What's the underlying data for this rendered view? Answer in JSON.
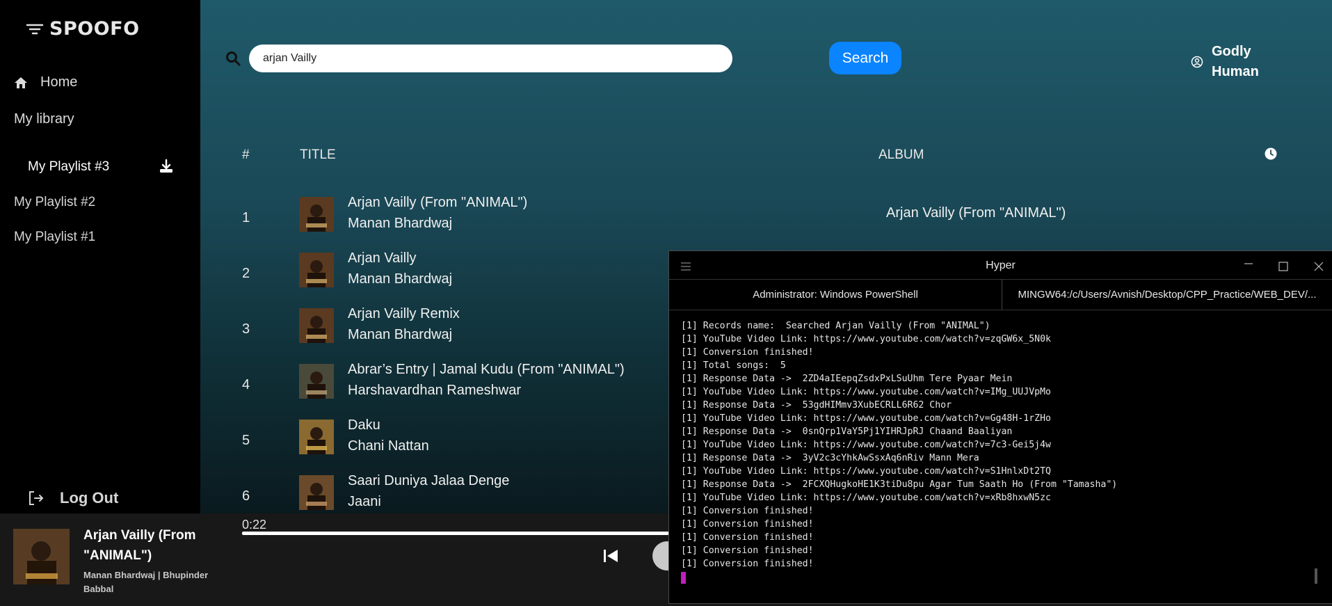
{
  "app": {
    "logo": "SPOOFO"
  },
  "sidebar": {
    "home": "Home",
    "library": "My library",
    "playlists": [
      "My Playlist #3",
      "My Playlist #2",
      "My Playlist #1"
    ],
    "logout": "Log Out"
  },
  "search": {
    "value": "arjan Vailly",
    "button": "Search"
  },
  "user": {
    "name": "Godly Human"
  },
  "table": {
    "headers": {
      "num": "#",
      "title": "TITLE",
      "album": "ALBUM"
    },
    "rows": [
      {
        "num": "1",
        "title": "Arjan Vailly (From \"ANIMAL\")",
        "artist": "Manan Bhardwaj",
        "album": "Arjan Vailly (From \"ANIMAL\")"
      },
      {
        "num": "2",
        "title": "Arjan Vailly",
        "artist": "Manan Bhardwaj"
      },
      {
        "num": "3",
        "title": "Arjan Vailly Remix",
        "artist": "Manan Bhardwaj"
      },
      {
        "num": "4",
        "title": "Abrar’s Entry | Jamal Kudu (From \"ANIMAL\")",
        "artist": "Harshavardhan Rameshwar"
      },
      {
        "num": "5",
        "title": "Daku",
        "artist": "Chani Nattan"
      },
      {
        "num": "6",
        "title": "Saari Duniya Jalaa Denge",
        "artist": "Jaani"
      }
    ]
  },
  "player": {
    "title": "Arjan Vailly (From \"ANIMAL\")",
    "artist": "Manan Bhardwaj | Bhupinder Babbal",
    "time": "0:22"
  },
  "terminal": {
    "title": "Hyper",
    "tabs": [
      "Administrator: Windows PowerShell",
      "MINGW64:/c/Users/Avnish/Desktop/CPP_Practice/WEB_DEV/..."
    ],
    "lines": [
      "[1] Records name:  Searched Arjan Vailly (From \"ANIMAL\")",
      "[1] YouTube Video Link: https://www.youtube.com/watch?v=zqGW6x_5N0k",
      "[1] Conversion finished!",
      "[1] Total songs:  5",
      "[1] Response Data ->  2ZD4aIEepqZsdxPxLSuUhm Tere Pyaar Mein",
      "[1] YouTube Video Link: https://www.youtube.com/watch?v=IMg_UUJVpMo",
      "[1] Response Data ->  53gdHIMmv3XubECRLL6R62 Chor",
      "[1] YouTube Video Link: https://www.youtube.com/watch?v=Gg48H-1rZHo",
      "[1] Response Data ->  0snQrp1VaY5Pj1YIHRJpRJ Chaand Baaliyan",
      "[1] YouTube Video Link: https://www.youtube.com/watch?v=7c3-Gei5j4w",
      "[1] Response Data ->  3yV2c3cYhkAwSsxAq6nRiv Mann Mera",
      "[1] YouTube Video Link: https://www.youtube.com/watch?v=S1HnlxDt2TQ",
      "[1] Response Data ->  2FCXQHugkoHE1K3tiDu8pu Agar Tum Saath Ho (From \"Tamasha\")",
      "[1] YouTube Video Link: https://www.youtube.com/watch?v=xRb8hxwN5zc",
      "[1] Conversion finished!",
      "[1] Conversion finished!",
      "[1] Conversion finished!",
      "[1] Conversion finished!",
      "[1] Conversion finished!"
    ]
  }
}
